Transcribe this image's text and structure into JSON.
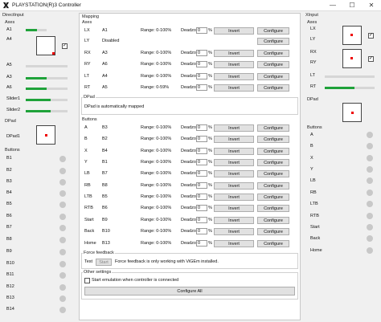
{
  "window": {
    "title": "PLAYSTATION(R)3 Controller",
    "minimize": "—",
    "maximize": "☐",
    "close": "✕"
  },
  "left": {
    "title": "DirectInput",
    "axes_title": "Axes",
    "axes": [
      {
        "label": "A1",
        "value": 0.55
      },
      {
        "label": "A4",
        "value": 0
      },
      {
        "label": "A5",
        "value": 0
      },
      {
        "label": "A3",
        "value": 0.5
      },
      {
        "label": "A6",
        "value": 0.5
      }
    ],
    "stick_checked": "✓",
    "sliders": [
      {
        "label": "Slider1",
        "value": 0.6
      },
      {
        "label": "Slider2",
        "value": 0.6
      }
    ],
    "dpad_title": "DPad",
    "dpad_label": "DPad1",
    "buttons_title": "Buttons",
    "buttons": [
      "B1",
      "B2",
      "B3",
      "B4",
      "B5",
      "B6",
      "B7",
      "B8",
      "B9",
      "B10",
      "B11",
      "B12",
      "B13",
      "B14"
    ]
  },
  "mid": {
    "title": "Mapping",
    "axes_title": "Axes",
    "axes": [
      {
        "name": "LX",
        "src": "A1",
        "range": "Range: 0-100%",
        "dz_label": "Deadzone:",
        "dz_value": "0",
        "pct": "%",
        "invert": "Invert",
        "configure": "Configure",
        "disabled": false
      },
      {
        "name": "LY",
        "src": "Disabled",
        "range": "",
        "dz_label": "",
        "dz_value": "",
        "pct": "",
        "invert": "",
        "configure": "Configure",
        "disabled": true
      },
      {
        "name": "RX",
        "src": "A3",
        "range": "Range: 0-100%",
        "dz_label": "Deadzone:",
        "dz_value": "0",
        "pct": "%",
        "invert": "Invert",
        "configure": "Configure",
        "disabled": false
      },
      {
        "name": "RY",
        "src": "A6",
        "range": "Range: 0-100%",
        "dz_label": "Deadzone:",
        "dz_value": "0",
        "pct": "%",
        "invert": "Invert",
        "configure": "Configure",
        "disabled": false
      },
      {
        "name": "LT",
        "src": "A4",
        "range": "Range: 0-100%",
        "dz_label": "Deadzone:",
        "dz_value": "0",
        "pct": "%",
        "invert": "Invert",
        "configure": "Configure",
        "disabled": false
      },
      {
        "name": "RT",
        "src": "A5",
        "range": "Range: 0-59%",
        "dz_label": "Deadzone:",
        "dz_value": "0",
        "pct": "%",
        "invert": "Invert",
        "configure": "Configure",
        "disabled": false
      }
    ],
    "dpad_title": "DPad",
    "dpad_text": "DPad is automatically mapped",
    "buttons_title": "Buttons",
    "buttons": [
      {
        "name": "A",
        "src": "B3"
      },
      {
        "name": "B",
        "src": "B2"
      },
      {
        "name": "X",
        "src": "B4"
      },
      {
        "name": "Y",
        "src": "B1"
      },
      {
        "name": "LB",
        "src": "B7"
      },
      {
        "name": "RB",
        "src": "B8"
      },
      {
        "name": "LTB",
        "src": "B5"
      },
      {
        "name": "RTB",
        "src": "B6"
      },
      {
        "name": "Start",
        "src": "B9"
      },
      {
        "name": "Back",
        "src": "B10"
      },
      {
        "name": "Home",
        "src": "B13"
      }
    ],
    "btn_range": "Range: 0-100%",
    "btn_dz_label": "Deadzone:",
    "btn_dz_value": "0",
    "btn_pct": "%",
    "invert": "Invert",
    "configure": "Configure",
    "ff_title": "Force feedback",
    "ff_test": "Test",
    "ff_start": "Start",
    "ff_text": "Force feedback is only working with ViGEm installed.",
    "other_title": "Other settings",
    "other_check_label": "Start emulation when controller is connected",
    "configure_all": "Configure All"
  },
  "right": {
    "title": "XInput",
    "axes_title": "Axes",
    "axes": [
      "LX",
      "LY",
      "RX",
      "RY",
      "LT",
      "RT"
    ],
    "lt_value": 0,
    "rt_value": 0.6,
    "stick_checked": "✓",
    "dpad_title": "DPad",
    "buttons_title": "Buttons",
    "buttons": [
      "A",
      "B",
      "X",
      "Y",
      "LB",
      "RB",
      "LTB",
      "RTB",
      "Start",
      "Back",
      "Home"
    ]
  }
}
